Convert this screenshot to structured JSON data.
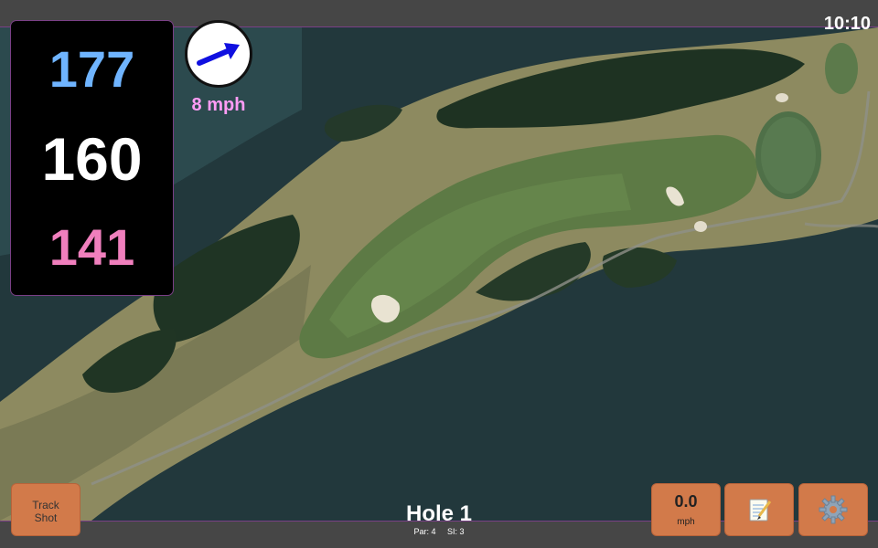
{
  "clock": "10:10",
  "distances": {
    "back": "177",
    "middle": "160",
    "front": "141"
  },
  "wind": {
    "speed": "8 mph",
    "direction_icon": "arrow-up-right-icon",
    "arrow_color": "#1010e0"
  },
  "hole": {
    "title": "Hole 1",
    "par": "Par: 4",
    "stroke_index": "SI: 3"
  },
  "buttons": {
    "track_shot_line1": "Track",
    "track_shot_line2": "Shot",
    "speed_value": "0.0",
    "speed_unit": "mph",
    "notes_icon": "notepad-icon",
    "settings_icon": "gear-icon"
  },
  "colors": {
    "back_distance": "#6fb4ff",
    "middle_distance": "#ffffff",
    "front_distance": "#f07fbd",
    "wind_text": "#ff9cf5",
    "button_bg": "#d27a4a",
    "accent_border": "#7a3f86"
  }
}
